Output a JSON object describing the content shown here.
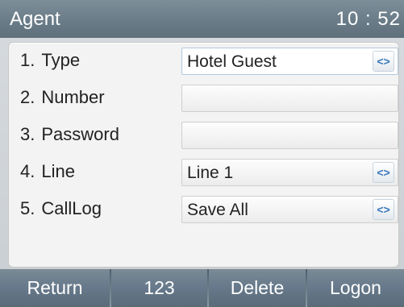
{
  "header": {
    "title": "Agent",
    "time": "10 : 52"
  },
  "form": {
    "rows": [
      {
        "num": "1.",
        "label": "Type",
        "value": "Hotel Guest",
        "spin": "<>"
      },
      {
        "num": "2.",
        "label": "Number",
        "value": ""
      },
      {
        "num": "3.",
        "label": "Password",
        "value": ""
      },
      {
        "num": "4.",
        "label": "Line",
        "value": "Line 1",
        "spin": "<>"
      },
      {
        "num": "5.",
        "label": "CallLog",
        "value": "Save All",
        "spin": "<>"
      }
    ]
  },
  "softkeys": {
    "return": "Return",
    "input_mode": "123",
    "delete": "Delete",
    "logon": "Logon"
  },
  "colors": {
    "accent": "#3a78b8",
    "bar": "#6a7c88"
  }
}
